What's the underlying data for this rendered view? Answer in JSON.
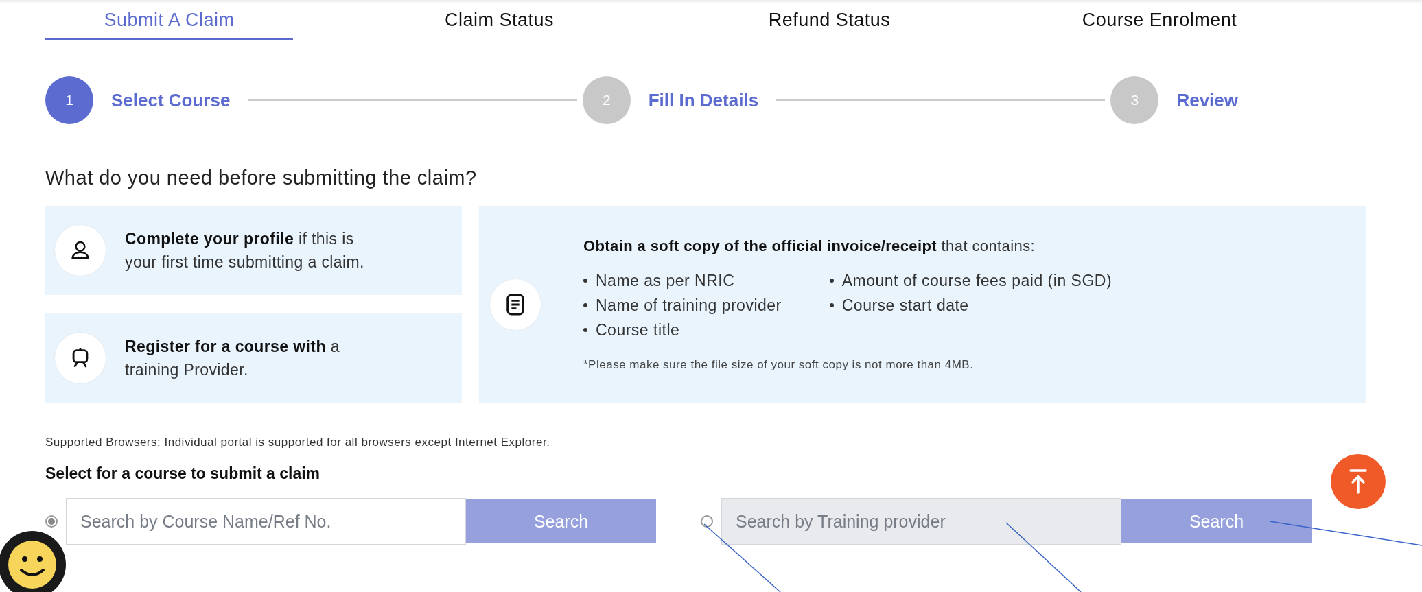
{
  "tabs": [
    {
      "label": "Submit A Claim",
      "selected": true
    },
    {
      "label": "Claim Status",
      "selected": false
    },
    {
      "label": "Refund Status",
      "selected": false
    },
    {
      "label": "Course Enrolment",
      "selected": false
    }
  ],
  "steps": [
    {
      "number": "1",
      "label": "Select Course",
      "active": true
    },
    {
      "number": "2",
      "label": "Fill In Details",
      "active": false
    },
    {
      "number": "3",
      "label": "Review",
      "active": false
    }
  ],
  "heading": "What do you need before submitting the claim?",
  "requirements": [
    {
      "kind": "profile",
      "text": "**Complete your profile** if this is your first time submitting a claim."
    },
    {
      "kind": "course",
      "text": "**Register for a course with** a training Provider."
    }
  ],
  "invoice_card": {
    "intro": "**Obtain a soft copy of the official invoice/receipt** that contains:",
    "items_col1": [
      "Name as per NRIC",
      "Name of training provider",
      "Course title"
    ],
    "items_col2": [
      "Amount of course fees paid (in SGD)",
      "Course start date"
    ],
    "note": "*Please make sure the file size of your soft copy is not more than 4MB."
  },
  "browser_note": "Supported Browsers: Individual portal is supported for all browsers except Internet Explorer.",
  "search_title": "Select for a course to submit a claim",
  "search_options": [
    {
      "selected": true,
      "disabled": false,
      "placeholder": "Search by Course Name/Ref No.",
      "button": "Search"
    },
    {
      "selected": false,
      "disabled": true,
      "placeholder": "Search by Training provider",
      "button": "Search"
    }
  ]
}
